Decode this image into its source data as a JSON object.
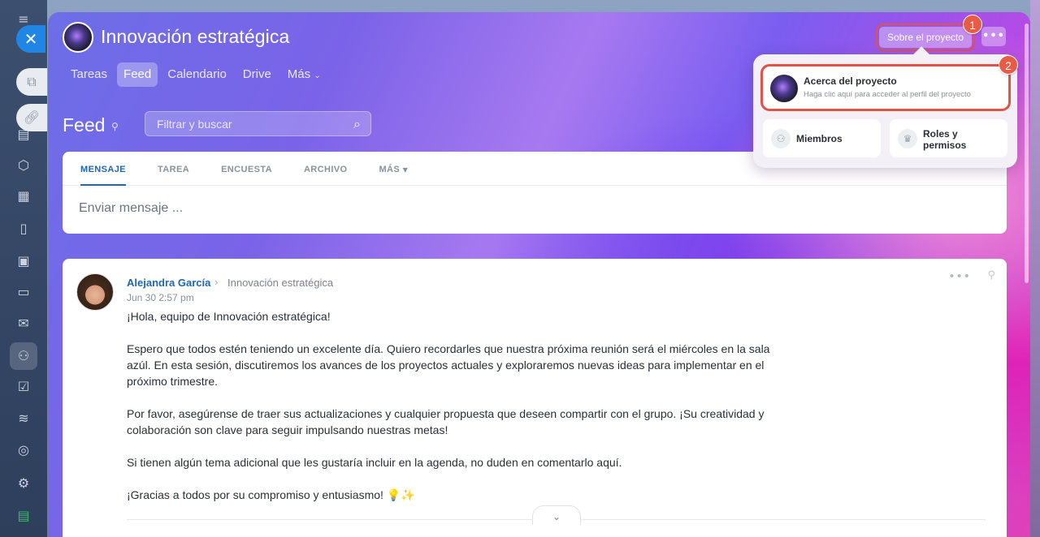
{
  "project": {
    "title": "Innovación estratégica"
  },
  "tabs": [
    {
      "label": "Tareas"
    },
    {
      "label": "Feed"
    },
    {
      "label": "Calendario"
    },
    {
      "label": "Drive"
    },
    {
      "label": "Más"
    }
  ],
  "header": {
    "about_button": "Sobre el proyecto",
    "more_button": "•••",
    "badge_1": "1",
    "badge_2": "2"
  },
  "feed": {
    "title": "Feed",
    "search_placeholder": "Filtrar y buscar"
  },
  "composer": {
    "tabs": [
      "MENSAJE",
      "TAREA",
      "ENCUESTA",
      "ARCHIVO",
      "MÁS"
    ],
    "placeholder": "Enviar mensaje ..."
  },
  "post": {
    "author": "Alejandra García",
    "group": "Innovación estratégica",
    "date": "Jun 30 2:57 pm",
    "paragraphs": [
      "¡Hola, equipo de Innovación estratégica!",
      "Espero que todos estén teniendo un excelente día. Quiero recordarles que nuestra próxima reunión será el miércoles en la sala azúl. En esta sesión, discutiremos los avances de los proyectos actuales y exploraremos nuevas ideas para implementar en el próximo trimestre.",
      "Por favor, asegúrense de traer sus actualizaciones y cualquier propuesta que deseen compartir con el grupo. ¡Su creatividad y colaboración son clave para seguir impulsando nuestras metas!",
      "Si tienen algún tema adicional que les gustaría incluir en la agenda, no duden en comentarlo aquí.",
      "¡Gracias a todos por su compromiso y entusiasmo! 💡✨"
    ]
  },
  "popup": {
    "about_title": "Acerca del proyecto",
    "about_desc": "Haga clic aquí para acceder al perfil del proyecto",
    "members": "Miembros",
    "roles_line1": "Roles y",
    "roles_line2": "permisos"
  },
  "colors": {
    "accent": "#2067b0",
    "highlight": "#e0524a",
    "close_button": "#1f86e6"
  }
}
